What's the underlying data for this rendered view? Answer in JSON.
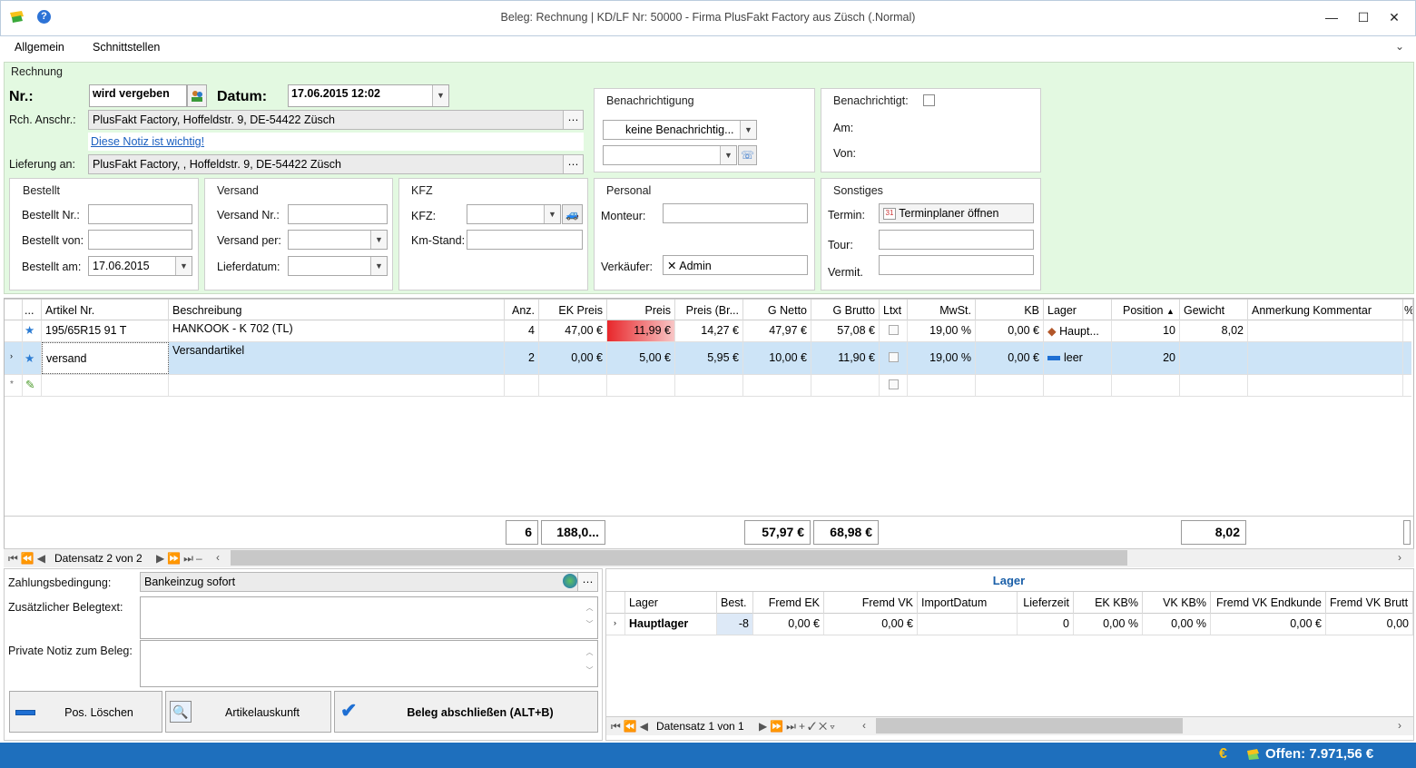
{
  "window": {
    "title": "Beleg: Rechnung |  KD/LF Nr: 50000 - Firma PlusFakt Factory  aus Züsch (.Normal)"
  },
  "menu": [
    "Allgemein",
    "Schnittstellen"
  ],
  "form": {
    "group_title": "Rechnung",
    "nr_label": "Nr.:",
    "nr_value": "wird vergeben",
    "datum_label": "Datum:",
    "datum_value": "17.06.2015 12:02",
    "anschr_label": "Rch. Anschr.:",
    "anschr_value": "PlusFakt Factory,  Hoffeldstr. 9,  DE-54422 Züsch",
    "note_link": "Diese Notiz ist wichtig!",
    "liefer_label": "Lieferung an:",
    "liefer_value": "PlusFakt Factory,  ,  Hoffeldstr. 9,  DE-54422 Züsch",
    "benachrichtigung": {
      "title": "Benachrichtigung",
      "value": "keine Benachrichtig..."
    },
    "benachrichtigt": {
      "title": "Benachrichtigt:",
      "am": "Am:",
      "von": "Von:"
    },
    "bestellt": {
      "title": "Bestellt",
      "nr": "Bestellt Nr.:",
      "von": "Bestellt von:",
      "am": "Bestellt am:",
      "am_value": "17.06.2015"
    },
    "versand": {
      "title": "Versand",
      "nr": "Versand Nr.:",
      "per": "Versand per:",
      "datum": "Lieferdatum:"
    },
    "kfz": {
      "title": "KFZ",
      "kfz": "KFZ:",
      "km": "Km-Stand:"
    },
    "personal": {
      "title": "Personal",
      "monteur": "Monteur:",
      "verkaeufer": "Verkäufer:",
      "verkaeufer_value": "Admin"
    },
    "sonstiges": {
      "title": "Sonstiges",
      "termin": "Termin:",
      "termin_btn": "Terminplaner öffnen",
      "tour": "Tour:",
      "vermit": "Vermit."
    }
  },
  "grid": {
    "headers": [
      "...",
      "Artikel Nr.",
      "Beschreibung",
      "Anz.",
      "EK Preis",
      "Preis",
      "Preis (Br...",
      "G Netto",
      "G Brutto",
      "Ltxt",
      "MwSt.",
      "KB",
      "Lager",
      "Position",
      "Gewicht",
      "Anmerkung Kommentar",
      "%"
    ],
    "rows": [
      {
        "artnr": "195/65R15 91 T",
        "beschr": "HANKOOK - K 702 (TL)",
        "anz": "4",
        "ek": "47,00 €",
        "preis": "11,99 €",
        "preisbr": "14,27 €",
        "gnetto": "47,97 €",
        "gbrutto": "57,08 €",
        "mwst": "19,00 %",
        "kb": "0,00 €",
        "lager": "Haupt...",
        "pos": "10",
        "gew": "8,02"
      },
      {
        "artnr": "versand",
        "beschr": "Versandartikel",
        "anz": "2",
        "ek": "0,00 €",
        "preis": "5,00 €",
        "preisbr": "5,95 €",
        "gnetto": "10,00 €",
        "gbrutto": "11,90 €",
        "mwst": "19,00 %",
        "kb": "0,00 €",
        "lager": "leer",
        "pos": "20",
        "gew": ""
      }
    ],
    "sums": {
      "anz": "6",
      "ek": "188,0...",
      "gnetto": "57,97 €",
      "gbrutto": "68,98 €",
      "gew": "8,02"
    },
    "nav": "Datensatz 2 von 2"
  },
  "bottom": {
    "zahlung_label": "Zahlungsbedingung:",
    "zahlung_value": "Bankeinzug sofort",
    "belegtext_label": "Zusätzlicher Belegtext:",
    "notiz_label": "Private Notiz zum Beleg:",
    "btn_loeschen": "Pos. Löschen",
    "btn_auskunft": "Artikelauskunft",
    "btn_abschliessen": "Beleg abschließen (ALT+B)"
  },
  "lager": {
    "title": "Lager",
    "headers": [
      "Lager",
      "Best.",
      "Fremd EK",
      "Fremd VK",
      "ImportDatum",
      "Lieferzeit",
      "EK KB%",
      "VK KB%",
      "Fremd VK Endkunde",
      "Fremd VK Brutt"
    ],
    "row": {
      "lager": "Hauptlager",
      "best": "-8",
      "fek": "0,00 €",
      "fvk": "0,00 €",
      "imp": "",
      "lz": "0",
      "ekkb": "0,00 %",
      "vkkb": "0,00 %",
      "fvke": "0,00 €",
      "fvkb": "0,00"
    },
    "nav": "Datensatz 1 von 1"
  },
  "status": {
    "offen": "Offen: 7.971,56 €"
  },
  "colors": {
    "green_bg": "#e3f9e1",
    "status_blue": "#1e6fbd",
    "selected_row": "#cde4f7",
    "price_red": "#e8272b"
  }
}
